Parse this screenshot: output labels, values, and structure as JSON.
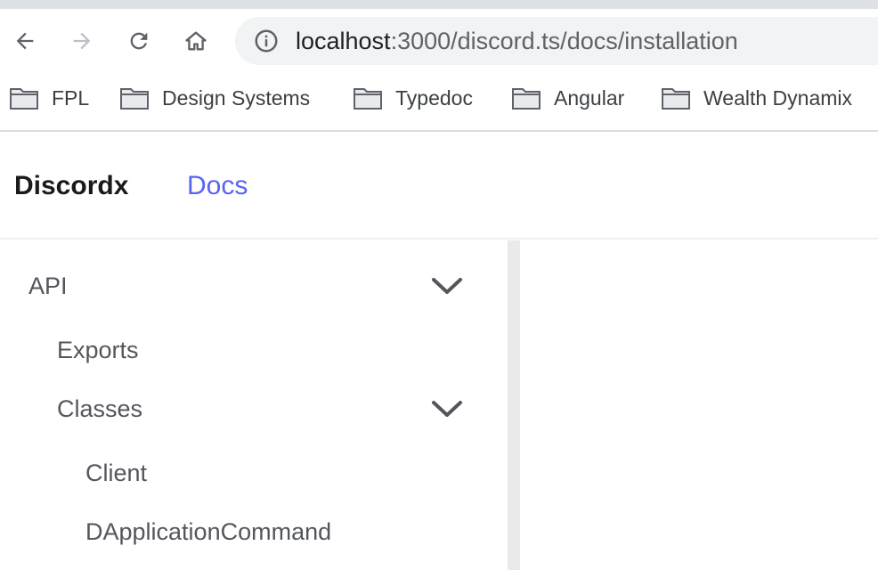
{
  "browser": {
    "url_host": "localhost",
    "url_rest": ":3000/discord.ts/docs/installation",
    "bookmarks": [
      {
        "label": "FPL"
      },
      {
        "label": "Design Systems"
      },
      {
        "label": "Typedoc"
      },
      {
        "label": "Angular"
      },
      {
        "label": "Wealth Dynamix"
      }
    ]
  },
  "header": {
    "brand": "Discordx",
    "docs_link": "Docs"
  },
  "sidebar": {
    "api": "API",
    "exports": "Exports",
    "classes": "Classes",
    "client": "Client",
    "dapplicationcommand": "DApplicationCommand"
  },
  "colors": {
    "accent": "#5865f2",
    "text": "#53565c"
  }
}
